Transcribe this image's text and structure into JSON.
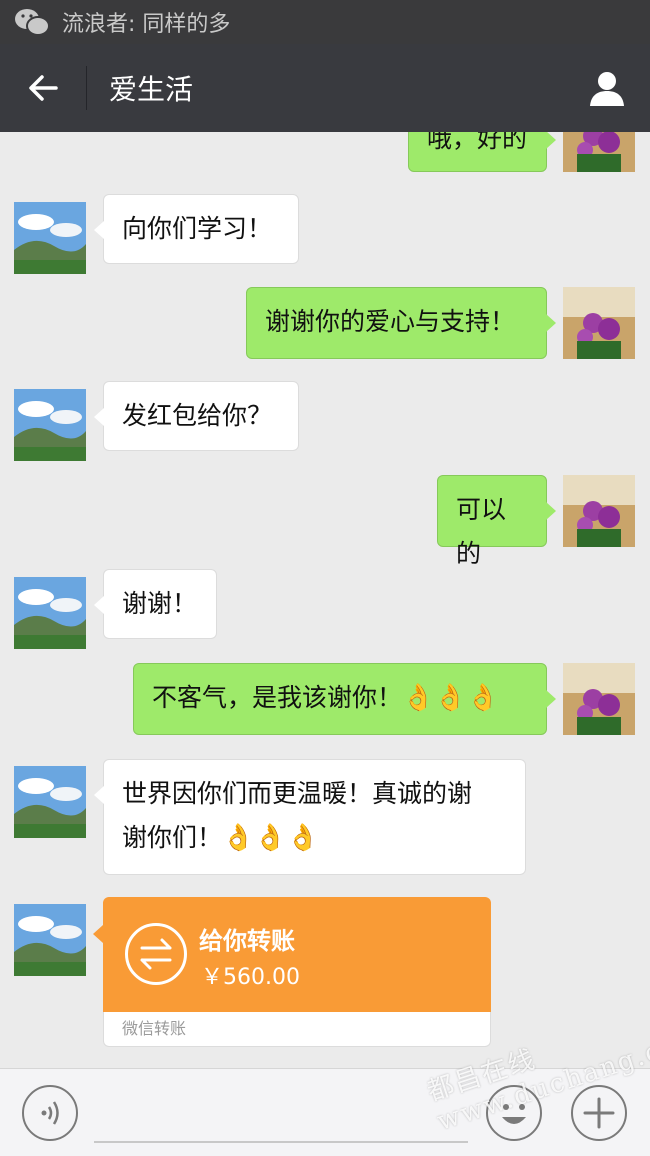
{
  "notification": {
    "text": "流浪者: 同样的多"
  },
  "header": {
    "title": "爱生活"
  },
  "messages": [
    {
      "side": "right",
      "text": "哦，好的"
    },
    {
      "side": "left",
      "text": "向你们学习！"
    },
    {
      "side": "right",
      "text": "谢谢你的爱心与支持！"
    },
    {
      "side": "left",
      "text": "发红包给你？"
    },
    {
      "side": "right",
      "text": "可以的"
    },
    {
      "side": "left",
      "text": "谢谢！"
    },
    {
      "side": "right",
      "text": "不客气，是我该谢你！",
      "emoji": "👌👌👌"
    },
    {
      "side": "left",
      "line1": "世界因你们而更温暖！真诚的谢",
      "line2": "谢你们！",
      "emoji": "👌👌👌"
    }
  ],
  "transfer": {
    "title": "给你转账",
    "amount": "￥560.00",
    "footer": "微信转账"
  },
  "watermark": {
    "text": "都昌在线 www.duchang.org"
  },
  "icons": [
    "wechat-icon",
    "back-arrow-icon",
    "person-icon",
    "voice-icon",
    "emoji-icon",
    "plus-icon",
    "transfer-icon"
  ]
}
